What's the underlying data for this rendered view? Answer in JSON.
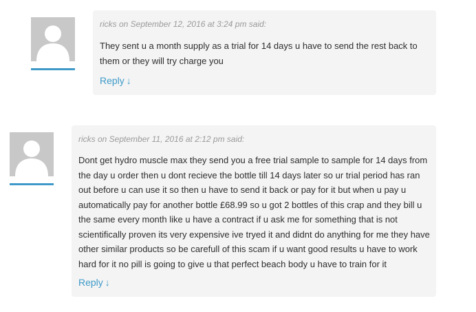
{
  "colors": {
    "accent": "#3d9ac8",
    "bubble_bg": "#f4f4f4",
    "avatar_bg": "#c8c8c8",
    "meta_text": "#9a9a9a",
    "body_text": "#2d2d2d"
  },
  "comments": [
    {
      "author": "ricks",
      "meta": "ricks on September 12, 2016 at 3:24 pm said:",
      "avatar_icon": "user-silhouette-icon",
      "text": "They sent u a month supply as a trial for 14 days u have to send the rest back to them or they will try charge you",
      "reply_label": "Reply",
      "reply_arrow": "↓"
    },
    {
      "author": "ricks",
      "meta": "ricks on September 11, 2016 at 2:12 pm said:",
      "avatar_icon": "user-silhouette-icon",
      "text": "Dont get hydro muscle max they send you a free trial sample to sample for 14 days from the day u order then u dont recieve the bottle till 14 days later so ur trial period has ran out before u can use it so then u have to send it back or pay for it but when u pay u automatically pay for another bottle £68.99 so u got 2 bottles of this crap and they bill u the same every month like u have a contract if u ask me for something that is not scientifically proven its very expensive ive tryed it and didnt do anything for me they have other similar products so be carefull of this scam if u want good results u have to work hard for it no pill is going to give u that perfect beach body u have to train for it",
      "reply_label": "Reply",
      "reply_arrow": "↓"
    }
  ]
}
